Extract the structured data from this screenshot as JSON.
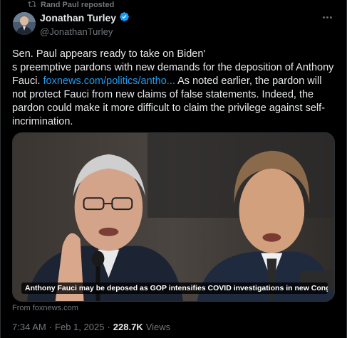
{
  "repost": {
    "label": "Rand Paul reposted",
    "icon": "repost-icon"
  },
  "author": {
    "name": "Jonathan Turley",
    "handle": "@JonathanTurley",
    "verified": true,
    "verified_color": "#1d9bf0"
  },
  "tweet": {
    "text_before_link": "Sen. Paul appears ready to take on Biden'\ns preemptive pardons with new demands for the deposition of Anthony Fauci. ",
    "link": "foxnews.com/politics/antho...",
    "text_after_link": " As noted earlier, the pardon will not protect Fauci from new claims of false statements. Indeed, the pardon could make it more difficult to claim the privilege against self-incrimination."
  },
  "card": {
    "caption": "Anthony Fauci may be deposed as GOP intensifies COVID investigations in new Congr...",
    "source": "From foxnews.com"
  },
  "meta": {
    "time": "7:34 AM",
    "sep1": "·",
    "date": "Feb 1, 2025",
    "sep2": "·",
    "views_count": "228.7K",
    "views_label": "Views"
  },
  "colors": {
    "background": "#000000",
    "text_primary": "#e7e9ea",
    "text_secondary": "#71767b",
    "link": "#1d9bf0",
    "border": "#2f3336"
  }
}
